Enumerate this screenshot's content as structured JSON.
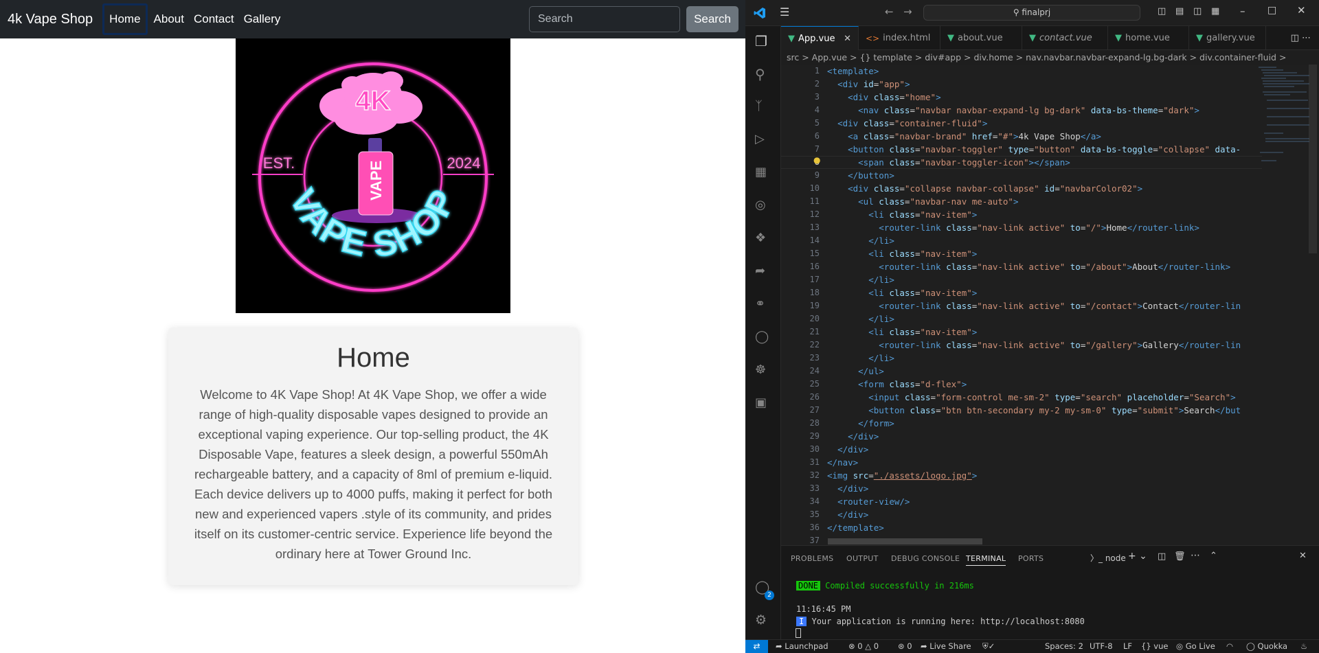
{
  "browser": {
    "brand": "4k Vape Shop",
    "nav": [
      "Home",
      "About",
      "Contact",
      "Gallery"
    ],
    "search_placeholder": "Search",
    "search_button": "Search",
    "logo": {
      "top_text": "4K",
      "left_text": "EST.",
      "right_text": "2024",
      "vape_text": "VAPE",
      "bottom_text": "VAPE SHOP"
    },
    "card": {
      "title": "Home",
      "body": "Welcome to 4K Vape Shop! At 4K Vape Shop, we offer a wide range of high-quality disposable vapes designed to provide an exceptional vaping experience. Our top-selling product, the 4K Disposable Vape, features a sleek design, a powerful 550mAh rechargeable battery, and a capacity of 8ml of premium e-liquid. Each device delivers up to 4000 puffs, making it perfect for both new and experienced vapers .style of its community, and prides itself on its customer-centric service. Experience life beyond the ordinary here at Tower Ground Inc."
    }
  },
  "vscode": {
    "search_label": "finalprj",
    "tabs": [
      "App.vue",
      "index.html",
      "about.vue",
      "contact.vue",
      "home.vue",
      "gallery.vue"
    ],
    "breadcrumb": "src  >  App.vue  >  {} template  >  div#app  >  div.home  >  nav.navbar.navbar-expand-lg.bg-dark  >  div.container-fluid  >",
    "line_numbers": [
      "1",
      "2",
      "3",
      "4",
      "5",
      "6",
      "7",
      "8",
      "9",
      "10",
      "11",
      "12",
      "13",
      "14",
      "15",
      "16",
      "17",
      "18",
      "19",
      "20",
      "21",
      "22",
      "23",
      "24",
      "25",
      "26",
      "27",
      "28",
      "29",
      "30",
      "31",
      "32",
      "33",
      "34",
      "35",
      "36",
      "37"
    ],
    "panel_tabs": [
      "PROBLEMS",
      "OUTPUT",
      "DEBUG CONSOLE",
      "TERMINAL",
      "PORTS"
    ],
    "terminal_shell": "node",
    "terminal": {
      "done_badge": "DONE",
      "done_msg": "Compiled successfully in 216ms",
      "time": "11:16:45 PM",
      "info_badge": "I",
      "info_msg": "Your application is running here: http://localhost:8080"
    },
    "status": {
      "launchpad": "Launchpad",
      "errors": "0",
      "warnings": "0",
      "ports": "0",
      "live_share": "Live Share",
      "spaces": "Spaces: 2",
      "encoding": "UTF-8",
      "eol": "LF",
      "language": "vue",
      "go_live": "Go Live",
      "quokka": "Quokka"
    },
    "account_badge": "2"
  }
}
